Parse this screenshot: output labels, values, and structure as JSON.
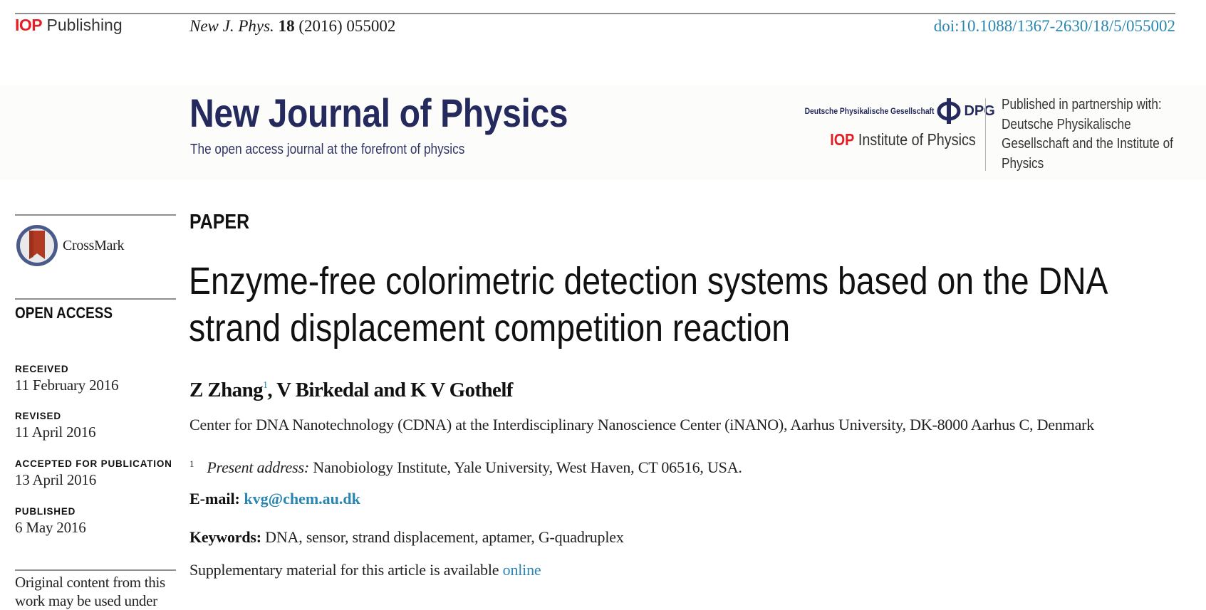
{
  "header": {
    "publisher_prefix": "IOP",
    "publisher_suffix": "Publishing",
    "journal_abbrev": "New J. Phys.",
    "volume": "18",
    "year_article": "(2016) 055002",
    "doi": "doi:10.1088/1367-2630/18/5/055002"
  },
  "masthead": {
    "journal_title": "New Journal of Physics",
    "tagline": "The open access journal at the forefront of  physics",
    "dpg_name": "Deutsche Physikalische Gesellschaft",
    "dpg_abbrev": "DPG",
    "iop_prefix": "IOP",
    "iop_name": "Institute of Physics",
    "partnership_text": "Published in partnership with: Deutsche Physikalische Gesellschaft and the Institute of Physics"
  },
  "sidebar": {
    "crossmark_label": "CrossMark",
    "access_label": "OPEN ACCESS",
    "history": [
      {
        "label": "RECEIVED",
        "date": "11 February 2016"
      },
      {
        "label": "REVISED",
        "date": "11 April 2016"
      },
      {
        "label": "ACCEPTED FOR PUBLICATION",
        "date": "13 April 2016"
      },
      {
        "label": "PUBLISHED",
        "date": "6 May 2016"
      }
    ],
    "license_text": "Original content from this work may be used under"
  },
  "article": {
    "type": "PAPER",
    "title": "Enzyme-free colorimetric detection systems based on the DNA strand displacement competition reaction",
    "authors": {
      "first": "Z Zhang",
      "first_sup": "1",
      "rest": ", V Birkedal and K V Gothelf"
    },
    "affiliation": "Center for DNA Nanotechnology (CDNA) at the Interdisciplinary Nanoscience Center (iNANO), Aarhus University, DK-8000 Aarhus C, Denmark",
    "footnote": {
      "mark": "1",
      "label": "Present address:",
      "text": " Nanobiology Institute, Yale University, West Haven, CT 06516, USA."
    },
    "email_label": "E-mail:",
    "email": "kvg@chem.au.dk",
    "keywords_label": "Keywords:",
    "keywords": " DNA, sensor, strand displacement, aptamer, G-quadruplex",
    "supplementary_text": "Supplementary material for this article is available ",
    "supplementary_link": "online"
  },
  "colors": {
    "link": "#2a86b0",
    "journal_navy": "#252a5e",
    "iop_red": "#e31e24"
  }
}
